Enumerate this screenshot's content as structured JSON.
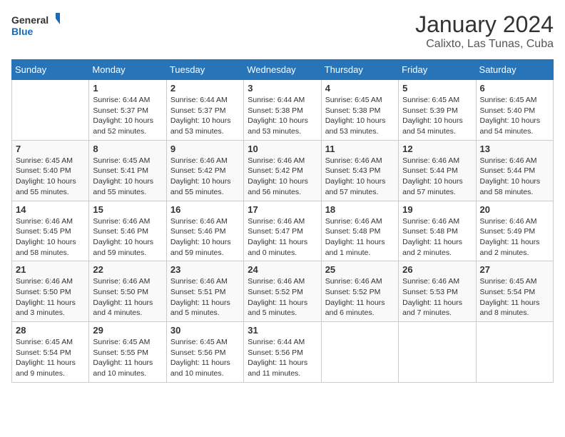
{
  "logo": {
    "general": "General",
    "blue": "Blue"
  },
  "title": "January 2024",
  "subtitle": "Calixto, Las Tunas, Cuba",
  "columns": [
    "Sunday",
    "Monday",
    "Tuesday",
    "Wednesday",
    "Thursday",
    "Friday",
    "Saturday"
  ],
  "weeks": [
    [
      {
        "day": "",
        "info": ""
      },
      {
        "day": "1",
        "info": "Sunrise: 6:44 AM\nSunset: 5:37 PM\nDaylight: 10 hours\nand 52 minutes."
      },
      {
        "day": "2",
        "info": "Sunrise: 6:44 AM\nSunset: 5:37 PM\nDaylight: 10 hours\nand 53 minutes."
      },
      {
        "day": "3",
        "info": "Sunrise: 6:44 AM\nSunset: 5:38 PM\nDaylight: 10 hours\nand 53 minutes."
      },
      {
        "day": "4",
        "info": "Sunrise: 6:45 AM\nSunset: 5:38 PM\nDaylight: 10 hours\nand 53 minutes."
      },
      {
        "day": "5",
        "info": "Sunrise: 6:45 AM\nSunset: 5:39 PM\nDaylight: 10 hours\nand 54 minutes."
      },
      {
        "day": "6",
        "info": "Sunrise: 6:45 AM\nSunset: 5:40 PM\nDaylight: 10 hours\nand 54 minutes."
      }
    ],
    [
      {
        "day": "7",
        "info": "Sunrise: 6:45 AM\nSunset: 5:40 PM\nDaylight: 10 hours\nand 55 minutes."
      },
      {
        "day": "8",
        "info": "Sunrise: 6:45 AM\nSunset: 5:41 PM\nDaylight: 10 hours\nand 55 minutes."
      },
      {
        "day": "9",
        "info": "Sunrise: 6:46 AM\nSunset: 5:42 PM\nDaylight: 10 hours\nand 55 minutes."
      },
      {
        "day": "10",
        "info": "Sunrise: 6:46 AM\nSunset: 5:42 PM\nDaylight: 10 hours\nand 56 minutes."
      },
      {
        "day": "11",
        "info": "Sunrise: 6:46 AM\nSunset: 5:43 PM\nDaylight: 10 hours\nand 57 minutes."
      },
      {
        "day": "12",
        "info": "Sunrise: 6:46 AM\nSunset: 5:44 PM\nDaylight: 10 hours\nand 57 minutes."
      },
      {
        "day": "13",
        "info": "Sunrise: 6:46 AM\nSunset: 5:44 PM\nDaylight: 10 hours\nand 58 minutes."
      }
    ],
    [
      {
        "day": "14",
        "info": "Sunrise: 6:46 AM\nSunset: 5:45 PM\nDaylight: 10 hours\nand 58 minutes."
      },
      {
        "day": "15",
        "info": "Sunrise: 6:46 AM\nSunset: 5:46 PM\nDaylight: 10 hours\nand 59 minutes."
      },
      {
        "day": "16",
        "info": "Sunrise: 6:46 AM\nSunset: 5:46 PM\nDaylight: 10 hours\nand 59 minutes."
      },
      {
        "day": "17",
        "info": "Sunrise: 6:46 AM\nSunset: 5:47 PM\nDaylight: 11 hours\nand 0 minutes."
      },
      {
        "day": "18",
        "info": "Sunrise: 6:46 AM\nSunset: 5:48 PM\nDaylight: 11 hours\nand 1 minute."
      },
      {
        "day": "19",
        "info": "Sunrise: 6:46 AM\nSunset: 5:48 PM\nDaylight: 11 hours\nand 2 minutes."
      },
      {
        "day": "20",
        "info": "Sunrise: 6:46 AM\nSunset: 5:49 PM\nDaylight: 11 hours\nand 2 minutes."
      }
    ],
    [
      {
        "day": "21",
        "info": "Sunrise: 6:46 AM\nSunset: 5:50 PM\nDaylight: 11 hours\nand 3 minutes."
      },
      {
        "day": "22",
        "info": "Sunrise: 6:46 AM\nSunset: 5:50 PM\nDaylight: 11 hours\nand 4 minutes."
      },
      {
        "day": "23",
        "info": "Sunrise: 6:46 AM\nSunset: 5:51 PM\nDaylight: 11 hours\nand 5 minutes."
      },
      {
        "day": "24",
        "info": "Sunrise: 6:46 AM\nSunset: 5:52 PM\nDaylight: 11 hours\nand 5 minutes."
      },
      {
        "day": "25",
        "info": "Sunrise: 6:46 AM\nSunset: 5:52 PM\nDaylight: 11 hours\nand 6 minutes."
      },
      {
        "day": "26",
        "info": "Sunrise: 6:46 AM\nSunset: 5:53 PM\nDaylight: 11 hours\nand 7 minutes."
      },
      {
        "day": "27",
        "info": "Sunrise: 6:45 AM\nSunset: 5:54 PM\nDaylight: 11 hours\nand 8 minutes."
      }
    ],
    [
      {
        "day": "28",
        "info": "Sunrise: 6:45 AM\nSunset: 5:54 PM\nDaylight: 11 hours\nand 9 minutes."
      },
      {
        "day": "29",
        "info": "Sunrise: 6:45 AM\nSunset: 5:55 PM\nDaylight: 11 hours\nand 10 minutes."
      },
      {
        "day": "30",
        "info": "Sunrise: 6:45 AM\nSunset: 5:56 PM\nDaylight: 11 hours\nand 10 minutes."
      },
      {
        "day": "31",
        "info": "Sunrise: 6:44 AM\nSunset: 5:56 PM\nDaylight: 11 hours\nand 11 minutes."
      },
      {
        "day": "",
        "info": ""
      },
      {
        "day": "",
        "info": ""
      },
      {
        "day": "",
        "info": ""
      }
    ]
  ]
}
